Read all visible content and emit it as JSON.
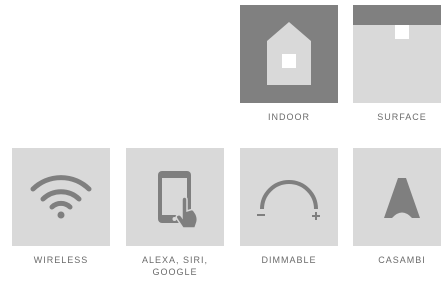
{
  "features": [
    {
      "id": "indoor",
      "label": "INDOOR",
      "icon": "house-icon"
    },
    {
      "id": "surface",
      "label": "SURFACE",
      "icon": "ceiling-mount-icon"
    },
    {
      "id": "wireless",
      "label": "WIRELESS",
      "icon": "wifi-icon"
    },
    {
      "id": "voice",
      "label_line1": "ALEXA, SIRI,",
      "label_line2": "GOOGLE",
      "icon": "smartphone-touch-icon"
    },
    {
      "id": "dimmable",
      "label": "DIMMABLE",
      "icon": "dimmer-dial-icon"
    },
    {
      "id": "casambi",
      "label": "CASAMBI",
      "icon": "casambi-logo-icon"
    }
  ],
  "colors": {
    "dark_tile": "#808080",
    "light_tile": "#d9d9d9",
    "icon_gray": "#7f7f7f",
    "label_gray": "#6b6b6b"
  }
}
